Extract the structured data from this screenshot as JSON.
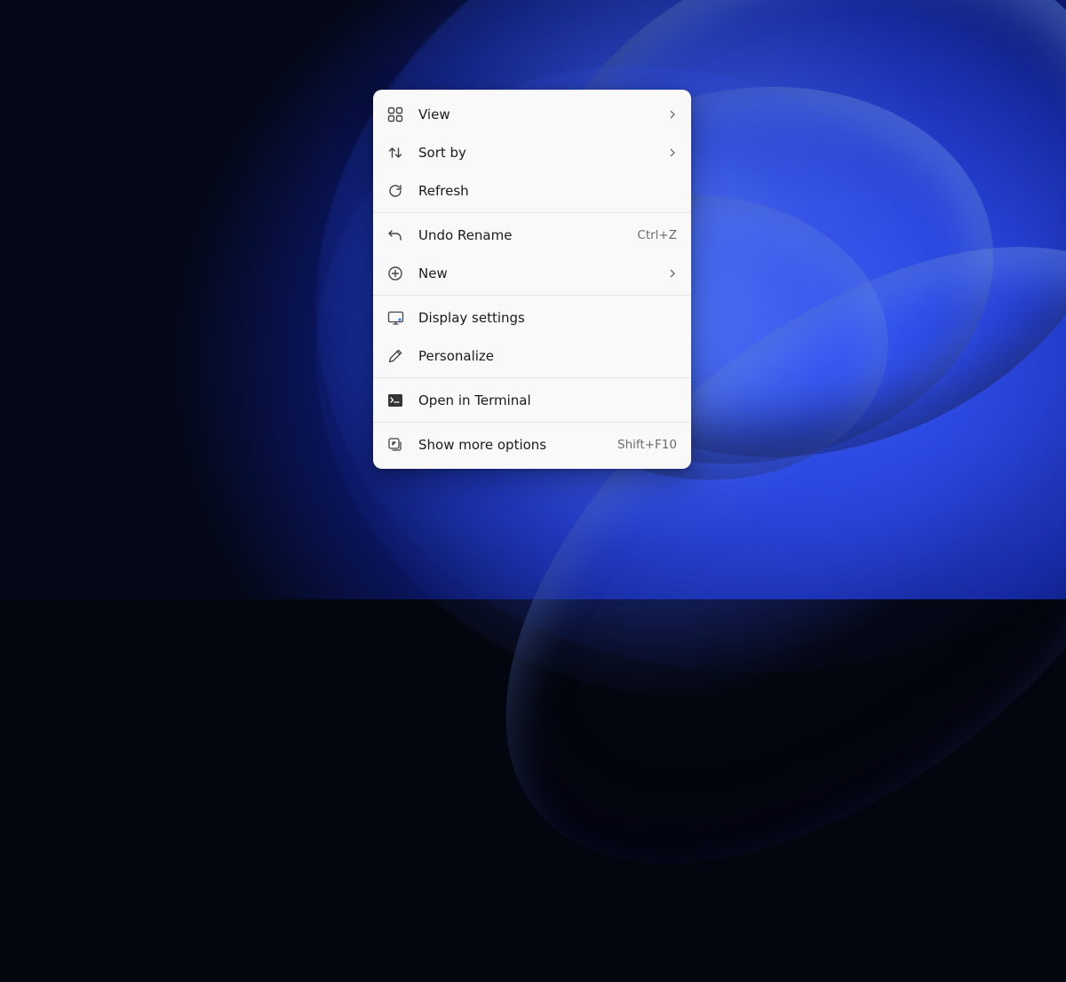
{
  "context_menu": {
    "items": [
      {
        "icon": "view",
        "label": "View",
        "has_submenu": true
      },
      {
        "icon": "sort",
        "label": "Sort by",
        "has_submenu": true
      },
      {
        "icon": "refresh",
        "label": "Refresh"
      },
      {
        "divider": true
      },
      {
        "icon": "undo",
        "label": "Undo Rename",
        "shortcut": "Ctrl+Z"
      },
      {
        "icon": "new",
        "label": "New",
        "has_submenu": true
      },
      {
        "divider": true
      },
      {
        "icon": "display",
        "label": "Display settings"
      },
      {
        "icon": "personalize",
        "label": "Personalize"
      },
      {
        "divider": true
      },
      {
        "icon": "terminal",
        "label": "Open in Terminal"
      },
      {
        "divider": true
      },
      {
        "icon": "more",
        "label": "Show more options",
        "shortcut": "Shift+F10"
      }
    ]
  }
}
